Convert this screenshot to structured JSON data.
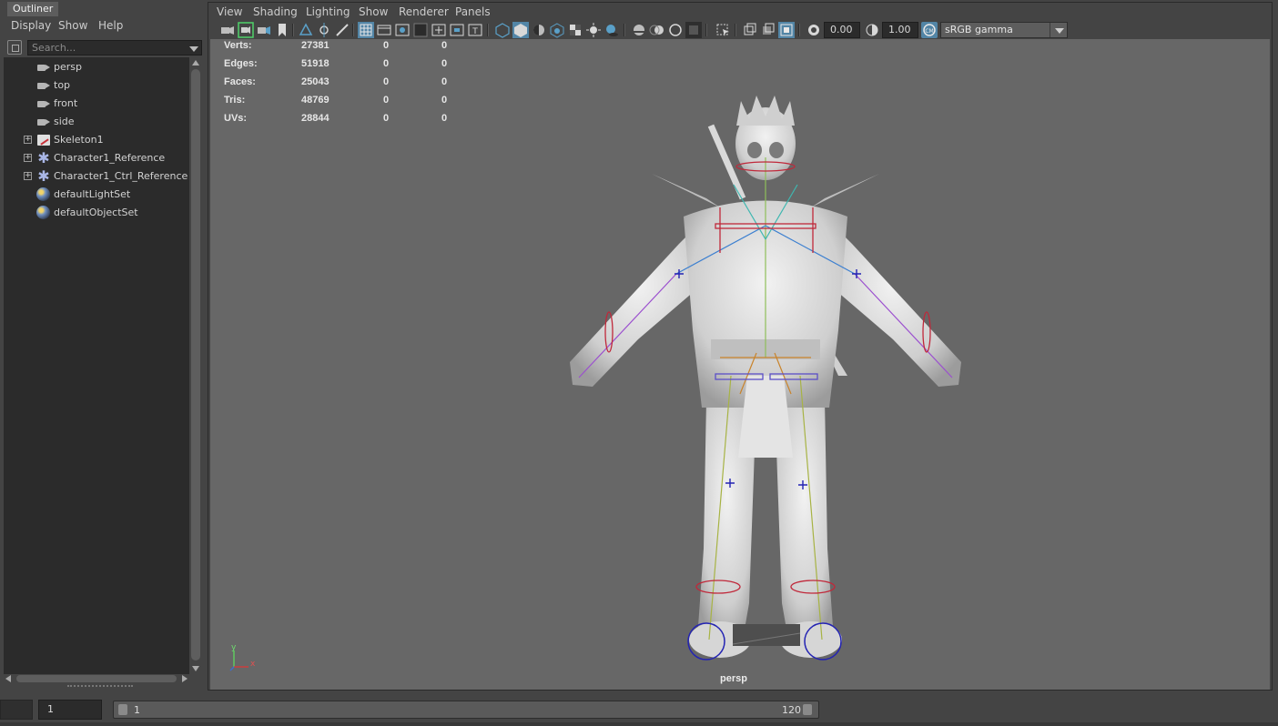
{
  "outliner": {
    "tab": "Outliner",
    "menu": [
      "Display",
      "Show",
      "Help"
    ],
    "search_placeholder": "Search...",
    "items": [
      {
        "label": "persp",
        "icon": "camera-icon"
      },
      {
        "label": "top",
        "icon": "camera-icon"
      },
      {
        "label": "front",
        "icon": "camera-icon"
      },
      {
        "label": "side",
        "icon": "camera-icon"
      },
      {
        "label": "Skeleton1",
        "icon": "skeleton-icon",
        "expandable": true
      },
      {
        "label": "Character1_Reference",
        "icon": "character-icon",
        "expandable": true
      },
      {
        "label": "Character1_Ctrl_Reference",
        "icon": "character-icon",
        "expandable": true
      },
      {
        "label": "defaultLightSet",
        "icon": "set-icon"
      },
      {
        "label": "defaultObjectSet",
        "icon": "set-icon"
      }
    ]
  },
  "viewport": {
    "menu": [
      "View",
      "Shading",
      "Lighting",
      "Show",
      "Renderer",
      "Panels"
    ],
    "exposure": "0.00",
    "gamma": "1.00",
    "color_space": "sRGB gamma",
    "camera_name": "persp",
    "hud": {
      "rows": [
        {
          "label": "Verts:",
          "v1": "27381",
          "v2": "0",
          "v3": "0"
        },
        {
          "label": "Edges:",
          "v1": "51918",
          "v2": "0",
          "v3": "0"
        },
        {
          "label": "Faces:",
          "v1": "25043",
          "v2": "0",
          "v3": "0"
        },
        {
          "label": "Tris:",
          "v1": "48769",
          "v2": "0",
          "v3": "0"
        },
        {
          "label": "UVs:",
          "v1": "28844",
          "v2": "0",
          "v3": "0"
        }
      ]
    },
    "axis": {
      "y": "y",
      "x": "x"
    }
  },
  "timeline": {
    "start_frame": "1",
    "range_start": "1",
    "range_end": "120"
  },
  "colors": {
    "scene_bg": "#676767",
    "panel_bg": "#444444",
    "field_bg": "#2b2b2b",
    "accent_blue": "#5285a6",
    "joint_blue": "#2323b3",
    "control_red": "#c0283a"
  }
}
